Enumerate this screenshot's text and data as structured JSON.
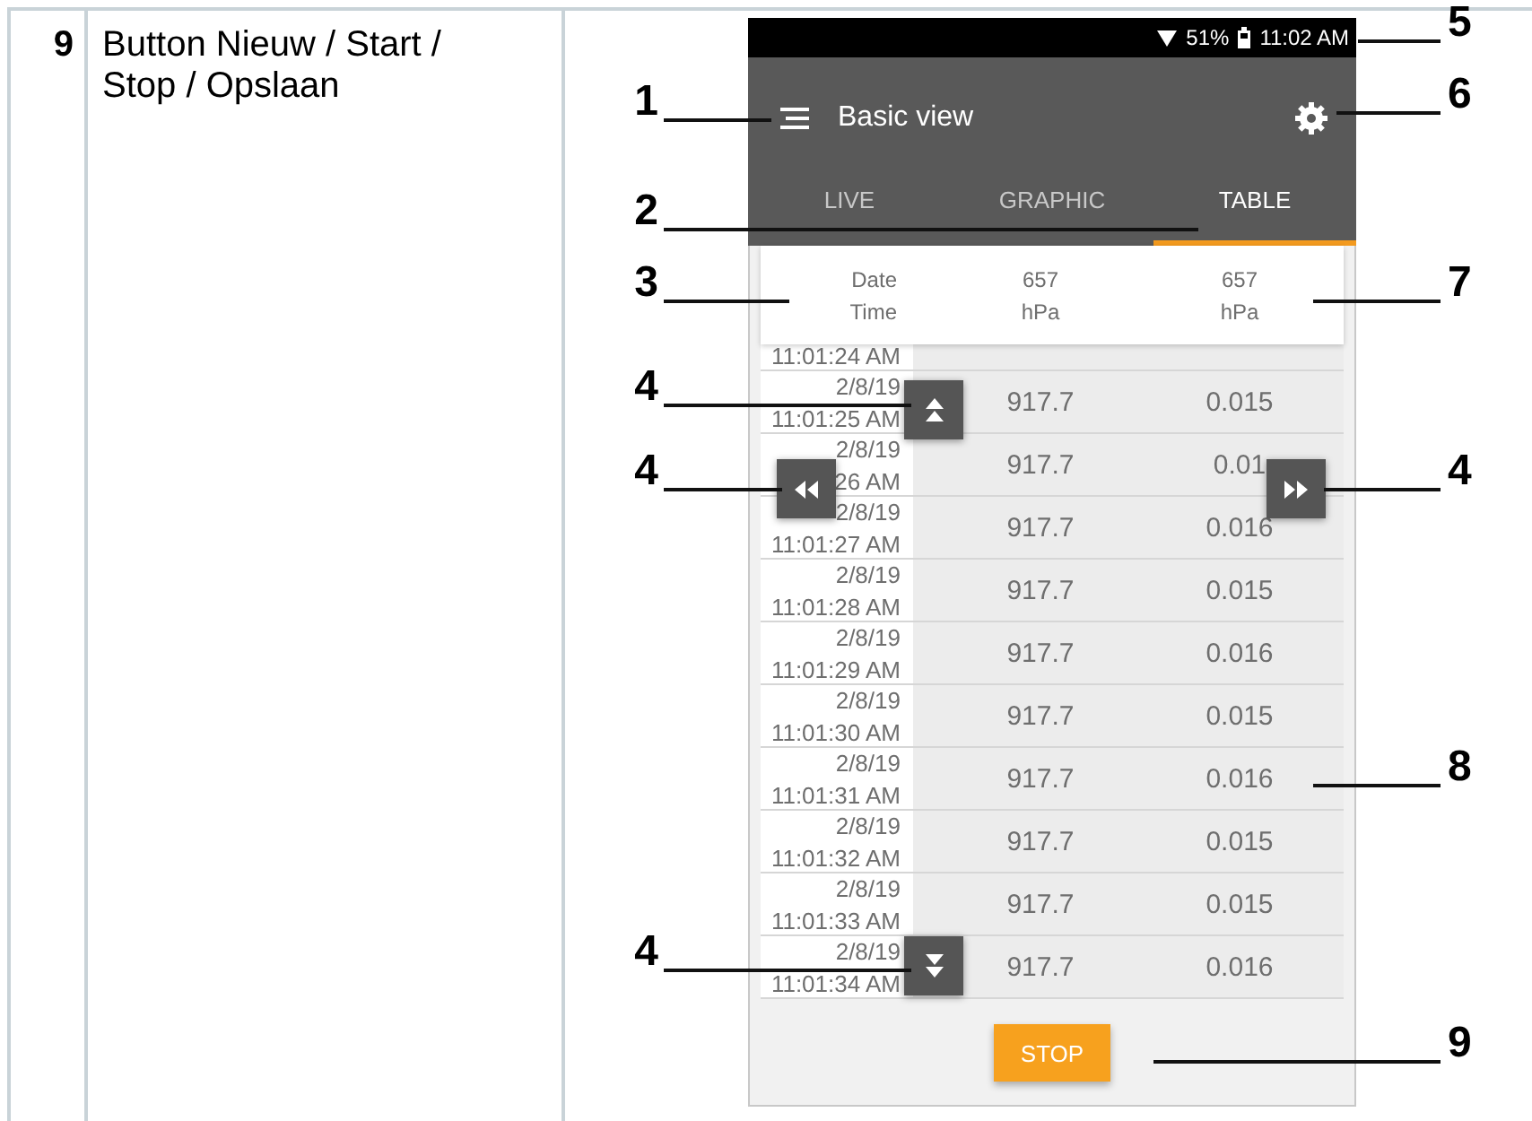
{
  "doc_row": {
    "number": "9",
    "description": "Button Nieuw / Start / Stop / Opslaan"
  },
  "phone": {
    "status_bar": {
      "battery_percent": "51%",
      "time": "11:02 AM"
    },
    "app_bar": {
      "title": "Basic view"
    },
    "tabs": [
      {
        "label": "LIVE",
        "selected": false
      },
      {
        "label": "GRAPHIC",
        "selected": false
      },
      {
        "label": "TABLE",
        "selected": true
      }
    ],
    "table": {
      "columns": [
        {
          "line_1": "Date",
          "line_2": "Time"
        },
        {
          "line_1": "657",
          "line_2": "hPa"
        },
        {
          "line_1": "657",
          "line_2": "hPa"
        }
      ],
      "partial_row": {
        "time": "11:01:24 AM"
      },
      "rows": [
        {
          "date": "2/8/19",
          "time": "11:01:25 AM",
          "value_1": "917.7",
          "value_2": "0.015"
        },
        {
          "date": "2/8/19",
          "time": "26 AM",
          "value_1": "917.7",
          "value_2": "0.01"
        },
        {
          "date": "2/8/19",
          "time": "11:01:27 AM",
          "value_1": "917.7",
          "value_2": "0.016"
        },
        {
          "date": "2/8/19",
          "time": "11:01:28 AM",
          "value_1": "917.7",
          "value_2": "0.015"
        },
        {
          "date": "2/8/19",
          "time": "11:01:29 AM",
          "value_1": "917.7",
          "value_2": "0.016"
        },
        {
          "date": "2/8/19",
          "time": "11:01:30 AM",
          "value_1": "917.7",
          "value_2": "0.015"
        },
        {
          "date": "2/8/19",
          "time": "11:01:31 AM",
          "value_1": "917.7",
          "value_2": "0.016"
        },
        {
          "date": "2/8/19",
          "time": "11:01:32 AM",
          "value_1": "917.7",
          "value_2": "0.015"
        },
        {
          "date": "2/8/19",
          "time": "11:01:33 AM",
          "value_1": "917.7",
          "value_2": "0.015"
        },
        {
          "date": "2/8/19",
          "time": "11:01:34 AM",
          "value_1": "917.7",
          "value_2": "0.016"
        }
      ]
    },
    "scroll_buttons": [
      {
        "kind": "up"
      },
      {
        "kind": "left"
      },
      {
        "kind": "right"
      },
      {
        "kind": "down"
      }
    ],
    "stop_button": {
      "label": "STOP"
    }
  },
  "callouts": [
    {
      "label": "5"
    },
    {
      "label": "1"
    },
    {
      "label": "6"
    },
    {
      "label": "2"
    },
    {
      "label": "3"
    },
    {
      "label": "7"
    },
    {
      "label": "4"
    },
    {
      "label": "4"
    },
    {
      "label": "4"
    },
    {
      "label": "8"
    },
    {
      "label": "4"
    },
    {
      "label": "9"
    }
  ]
}
